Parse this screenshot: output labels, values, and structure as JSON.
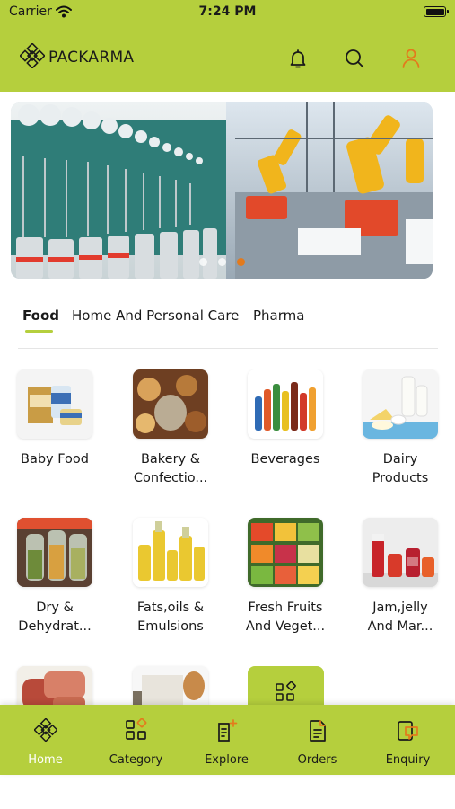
{
  "status_bar": {
    "carrier": "Carrier",
    "time": "7:24 PM"
  },
  "header": {
    "brand": "PACKARMA",
    "icons": [
      "notification-bell-icon",
      "search-icon",
      "user-profile-icon"
    ]
  },
  "banner": {
    "slides": 3,
    "active_slide": 3
  },
  "tabs": [
    {
      "label": "Food",
      "active": true
    },
    {
      "label": "Home And Personal Care",
      "active": false
    },
    {
      "label": "Pharma",
      "active": false
    }
  ],
  "categories": [
    {
      "label_line1": "Baby Food",
      "label_line2": ""
    },
    {
      "label_line1": "Bakery &",
      "label_line2": "Confectio..."
    },
    {
      "label_line1": "Beverages",
      "label_line2": ""
    },
    {
      "label_line1": "Dairy",
      "label_line2": "Products"
    },
    {
      "label_line1": "Dry &",
      "label_line2": "Dehydrat..."
    },
    {
      "label_line1": "Fats,oils &",
      "label_line2": "Emulsions"
    },
    {
      "label_line1": "Fresh Fruits",
      "label_line2": "And Veget..."
    },
    {
      "label_line1": "Jam,jelly",
      "label_line2": "And Mar..."
    }
  ],
  "bottom_nav": [
    {
      "label": "Home",
      "icon": "home-logo-icon",
      "active": true
    },
    {
      "label": "Category",
      "icon": "category-grid-icon",
      "active": false
    },
    {
      "label": "Explore",
      "icon": "explore-document-icon",
      "active": false
    },
    {
      "label": "Orders",
      "icon": "orders-document-icon",
      "active": false
    },
    {
      "label": "Enquiry",
      "icon": "enquiry-chat-icon",
      "active": false
    }
  ],
  "colors": {
    "brand": "#b5cf3d",
    "active_dot": "#e37a1c",
    "active_nav_label": "#ffffff"
  }
}
